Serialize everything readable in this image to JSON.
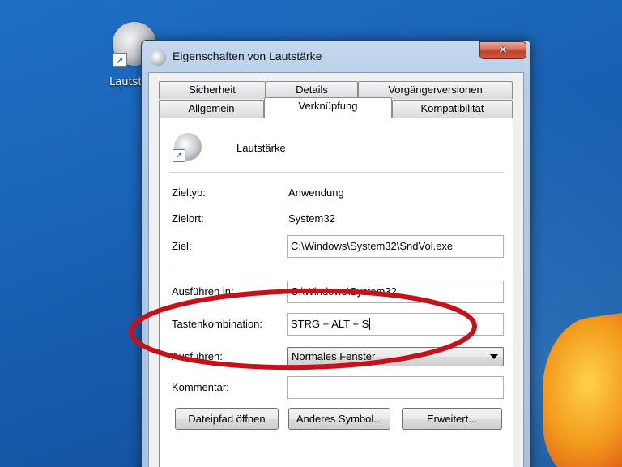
{
  "desktop": {
    "icon_label": "Lautst"
  },
  "window": {
    "title": "Eigenschaften von Lautstärke",
    "close_glyph": "✕"
  },
  "tabs": {
    "row1": [
      "Sicherheit",
      "Details",
      "Vorgängerversionen"
    ],
    "row2": [
      "Allgemein",
      "Verknüpfung",
      "Kompatibilität"
    ],
    "active": "Verknüpfung"
  },
  "shortcut": {
    "app_name": "Lautstärke",
    "fields": {
      "zieltyp_label": "Zieltyp:",
      "zieltyp_value": "Anwendung",
      "zielort_label": "Zielort:",
      "zielort_value": "System32",
      "ziel_label": "Ziel:",
      "ziel_value": "C:\\Windows\\System32\\SndVol.exe",
      "ausfuehren_in_label": "Ausführen in:",
      "ausfuehren_in_value": "C:\\Windows\\System32",
      "taste_label": "Tastenkombination:",
      "taste_value": "STRG + ALT + S",
      "ausfuehren_label": "Ausführen:",
      "ausfuehren_value": "Normales Fenster",
      "kommentar_label": "Kommentar:",
      "kommentar_value": ""
    },
    "buttons": {
      "open_path": "Dateipfad öffnen",
      "change_icon": "Anderes Symbol...",
      "advanced": "Erweitert..."
    }
  },
  "annotation": {
    "color": "#c8101a"
  },
  "colors": {
    "desktop": "#1a63b6",
    "close_button": "#c2402c"
  },
  "icons": [
    "speaker-icon",
    "shortcut-arrow-icon",
    "close-icon",
    "dropdown-caret-icon"
  ]
}
